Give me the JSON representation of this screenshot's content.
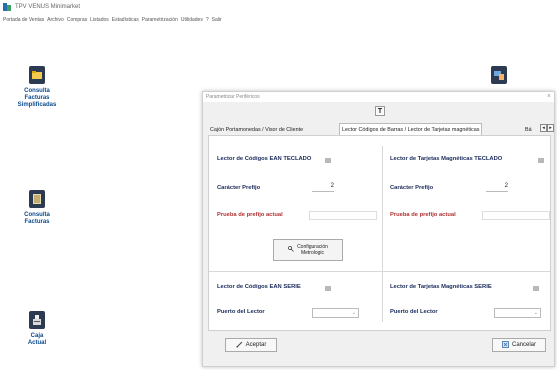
{
  "window": {
    "title": "TPV VENUS Minimarket",
    "app_icon": "app-logo-icon"
  },
  "menubar": {
    "items": [
      "Portada de Ventas",
      "Archivo",
      "Compras",
      "Listados",
      "Estadísticas",
      "Parametrización",
      "Utilidades",
      "?",
      "Salir"
    ]
  },
  "desktop": {
    "icons": [
      {
        "label_lines": [
          "Consulta",
          "Facturas",
          "Simplificadas"
        ],
        "icon": "folder-icon"
      },
      {
        "label_lines": [
          "Consulta",
          "Facturas"
        ],
        "icon": "invoice-book-icon"
      },
      {
        "label_lines": [
          "Caja",
          "Actual"
        ],
        "icon": "cash-register-icon"
      },
      {
        "label_lines": [],
        "icon": "devices-icon"
      }
    ]
  },
  "dialog": {
    "title": "Parametrizar Periféricos",
    "close_glyph": "×",
    "t_button": "T",
    "tabs": [
      {
        "label": "Cajón Portamonedas / Visor de Cliente",
        "active": false
      },
      {
        "label": "Lector Códigos de Barras / Lector de Tarjetas magnéticas",
        "active": true
      },
      {
        "label": "Bá",
        "active": false
      }
    ],
    "tab_prev": "◂",
    "tab_next": "▸",
    "left": {
      "teclado_title": "Lector de Códigos EAN TECLADO",
      "prefix_label": "Carácter Prefijo",
      "prefix_value": "2",
      "test_label": "Prueba de prefijo actual",
      "config_button_line1": "Configuración",
      "config_button_line2": "Metrologic",
      "serie_title": "Lector de Códigos EAN SERIE",
      "port_label": "Puerto del Lector"
    },
    "right": {
      "teclado_title": "Lector de Tarjetas Magnéticas TECLADO",
      "prefix_label": "Carácter Prefijo",
      "prefix_value": "2",
      "test_label": "Prueba de prefijo actual",
      "serie_title": "Lector de Tarjetas Magnéticas SERIE",
      "port_label": "Puerto del Lector"
    },
    "accept_label": "Aceptar",
    "cancel_label": "Cancelar"
  },
  "colors": {
    "label_blue": "#1a2a5a",
    "label_red": "#b03030",
    "desktop_label": "#0a4a8c"
  }
}
